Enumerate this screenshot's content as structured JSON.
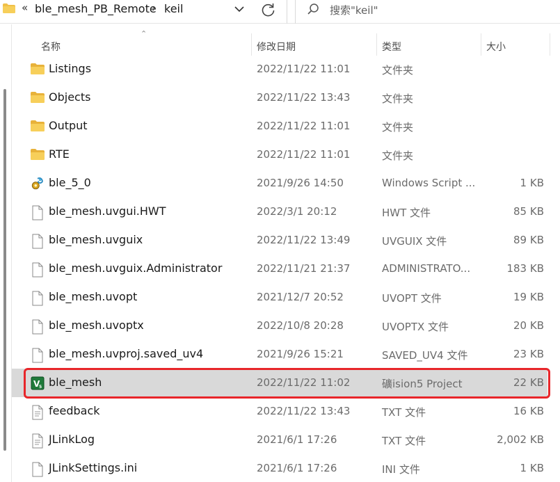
{
  "breadcrumb": {
    "overflow": "«",
    "parent": "ble_mesh_PB_Remote",
    "separator": "›",
    "current": "keil"
  },
  "search": {
    "placeholder": "搜索\"keil\""
  },
  "columns": {
    "name": "名称",
    "modified": "修改日期",
    "type": "类型",
    "size": "大小"
  },
  "colors": {
    "selected_row": "#d9d9d9",
    "highlight_border": "#e8262a",
    "folder": "#f0c048"
  },
  "files": [
    {
      "icon": "folder-icon",
      "name": "Listings",
      "modified": "2022/11/22 11:01",
      "type": "文件夹",
      "size": ""
    },
    {
      "icon": "folder-icon",
      "name": "Objects",
      "modified": "2022/11/22 13:43",
      "type": "文件夹",
      "size": ""
    },
    {
      "icon": "folder-icon",
      "name": "Output",
      "modified": "2022/11/22 11:01",
      "type": "文件夹",
      "size": ""
    },
    {
      "icon": "folder-icon",
      "name": "RTE",
      "modified": "2022/11/22 11:01",
      "type": "文件夹",
      "size": ""
    },
    {
      "icon": "script-gear-icon",
      "name": "ble_5_0",
      "modified": "2021/9/26 14:50",
      "type": "Windows Script ...",
      "size": "1 KB"
    },
    {
      "icon": "file-icon",
      "name": "ble_mesh.uvgui.HWT",
      "modified": "2022/3/1 20:12",
      "type": "HWT 文件",
      "size": "85 KB"
    },
    {
      "icon": "file-icon",
      "name": "ble_mesh.uvguix",
      "modified": "2022/11/22 13:49",
      "type": "UVGUIX 文件",
      "size": "89 KB"
    },
    {
      "icon": "file-icon",
      "name": "ble_mesh.uvguix.Administrator",
      "modified": "2022/11/21 21:37",
      "type": "ADMINISTRATO...",
      "size": "183 KB"
    },
    {
      "icon": "file-icon",
      "name": "ble_mesh.uvopt",
      "modified": "2021/12/7 20:52",
      "type": "UVOPT 文件",
      "size": "19 KB"
    },
    {
      "icon": "file-icon",
      "name": "ble_mesh.uvoptx",
      "modified": "2022/10/8 20:28",
      "type": "UVOPTX 文件",
      "size": "20 KB"
    },
    {
      "icon": "file-icon",
      "name": "ble_mesh.uvproj.saved_uv4",
      "modified": "2021/9/26 15:21",
      "type": "SAVED_UV4 文件",
      "size": "23 KB"
    },
    {
      "icon": "keil-project-icon",
      "name": "ble_mesh",
      "modified": "2022/11/22 11:02",
      "type": "礦ision5 Project",
      "size": "22 KB",
      "selected": true
    },
    {
      "icon": "text-file-icon",
      "name": "feedback",
      "modified": "2022/11/22 13:43",
      "type": "TXT 文件",
      "size": "16 KB"
    },
    {
      "icon": "text-file-icon",
      "name": "JLinkLog",
      "modified": "2021/6/1 17:26",
      "type": "TXT 文件",
      "size": "2,002 KB"
    },
    {
      "icon": "file-icon",
      "name": "JLinkSettings.ini",
      "modified": "2021/6/1 17:26",
      "type": "INI 文件",
      "size": "1 KB"
    }
  ]
}
